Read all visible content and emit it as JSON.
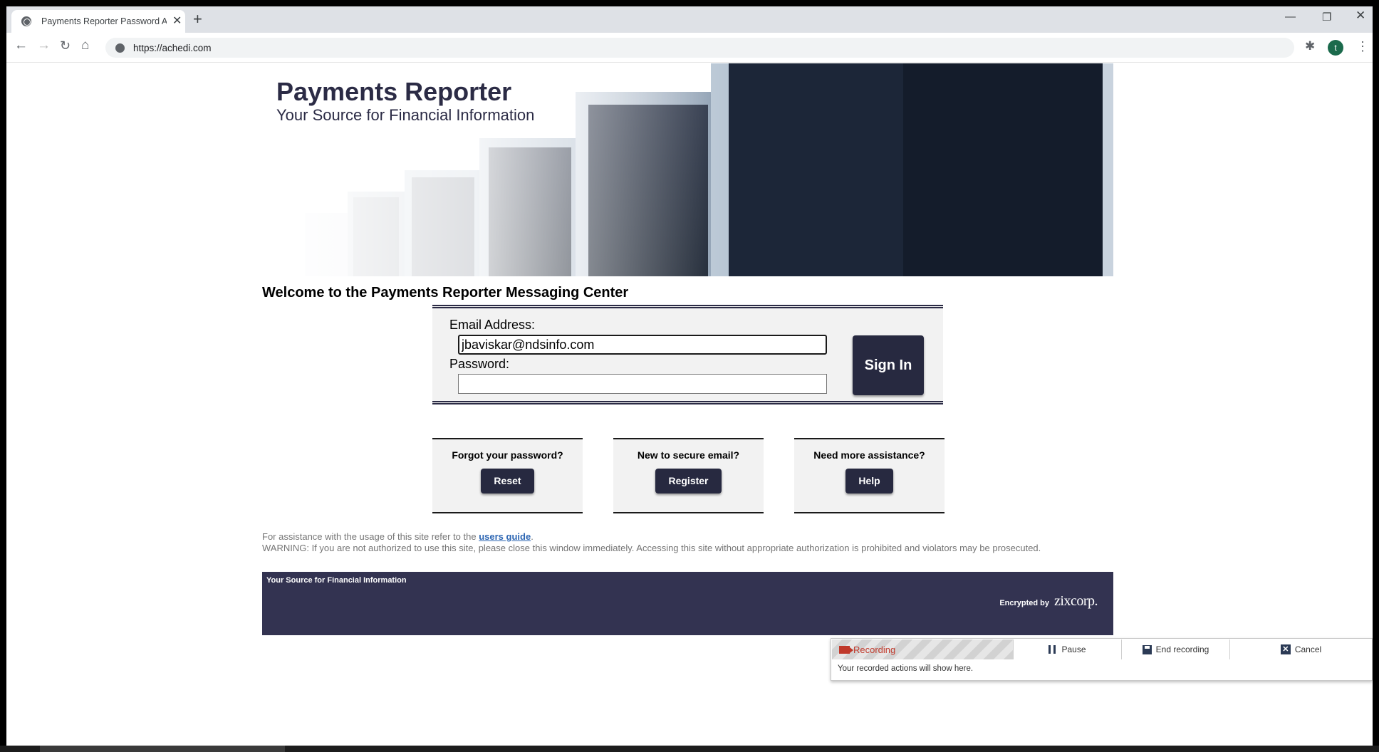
{
  "browser": {
    "tab_title": "Payments Reporter Password Au",
    "url": "https://achedi.com",
    "profile_initial": "t",
    "icons": [
      "site-globe-icon",
      "close-icon",
      "plus-icon",
      "minimize-icon",
      "restore-icon",
      "back-arrow-icon",
      "forward-arrow-icon",
      "reload-icon",
      "home-icon",
      "site-info-icon",
      "extensions-icon",
      "kebab-menu-icon"
    ]
  },
  "banner": {
    "title": "Payments Reporter",
    "subtitle": "Your Source for Financial Information"
  },
  "welcome": "Welcome to the Payments Reporter Messaging Center",
  "login": {
    "email_label": "Email Address:",
    "email_value": "jbaviskar@ndsinfo.com",
    "password_label": "Password:",
    "password_value": "",
    "signin_label": "Sign In"
  },
  "assist": [
    {
      "question": "Forgot your password?",
      "button": "Reset"
    },
    {
      "question": "New to secure email?",
      "button": "Register"
    },
    {
      "question": "Need more assistance?",
      "button": "Help"
    }
  ],
  "notes": {
    "assist_prefix": "For assistance with the usage of this site refer to the ",
    "assist_link": "users guide",
    "assist_suffix": ".",
    "warning": "WARNING: If you are not authorized to use this site, please close this window immediately. Accessing this site without appropriate authorization is prohibited and violators may be prosecuted."
  },
  "footer": {
    "tagline": "Your Source for Financial Information",
    "encrypted_label": "Encrypted by",
    "brand": "zixcorp."
  },
  "recorder": {
    "status": "Recording",
    "pause": "Pause",
    "end": "End recording",
    "cancel": "Cancel",
    "message": "Your recorded actions will show here."
  },
  "colors": {
    "brand_navy": "#272940",
    "footer_bg": "#333351",
    "link": "#2d66b3",
    "recording_red": "#c0392b"
  }
}
